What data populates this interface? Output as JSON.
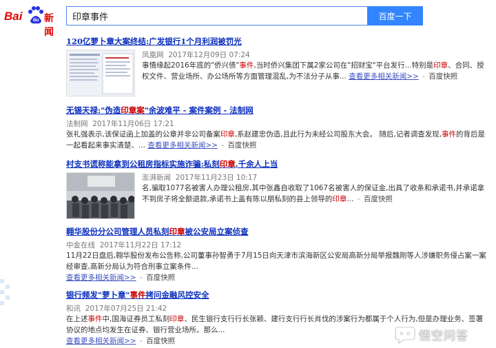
{
  "logo": {
    "bai": "Bai",
    "news": "新闻"
  },
  "search": {
    "query": "印章事件",
    "button_label": "百度一下"
  },
  "results": [
    {
      "title_parts": [
        "120亿萝卜章大案终结:广发银行1个月利润被罚光"
      ],
      "source": "凤凰网",
      "time": "2017年12月09日 07:24",
      "snippet_a": "事情缘起2016年底的\"侨兴债\"",
      "snippet_em1": "事件",
      "snippet_b": ",当时侨兴集团下属2家公司在\"招财宝\"平台发行...特别是",
      "snippet_em2": "印章",
      "snippet_c": "、合同、授权文件、营业场所、办公场所等方面管理混乱,为不法分子从事...",
      "more": "查看更多相关新闻>>",
      "cache": "百度快照"
    },
    {
      "title_a": "无锡天禄:\"伪造",
      "title_em": "印章案",
      "title_b": "\"余波难平 - 案件案例 - 法制网",
      "source": "法制网",
      "time": "2017年11月06日 17:21",
      "snippet_a": "张礼强表示,该保证函上加盖的公章并非公司备案",
      "snippet_em1": "印章",
      "snippet_b": ",系赵建忠伪造,且此行为未经公司股东大会。 随后,记者调查发现,",
      "snippet_em2": "事件",
      "snippet_c": "的背后是一起看起来事实清楚、...",
      "more": "查看更多相关新闻>>",
      "cache": "百度快照"
    },
    {
      "title_a": "村支书谎称能拿到公租房指标实施诈骗:私刻",
      "title_em": "印章",
      "title_b": ",千余人上当",
      "source": "澎湃新闻",
      "time": "2017年11月23日 10:17",
      "snippet_a": "名,骗取1077名被害人办理公租房,其中张鑫自收取了1067名被害人的保证金,出具了收条和承诺书,并承诺拿不到房子将全额退款,承诺书上盖有陈以朋私刻的县上领导的",
      "snippet_em1": "印章",
      "snippet_b": "...",
      "cache": "百度快照"
    },
    {
      "title_a": "翱华股份分公司管理人员私刻",
      "title_em": "印章",
      "title_b": "被公安局立案侦查",
      "source": "中金在线",
      "time": "2017年11月22日 17:12",
      "snippet_a": "11月22日盘后,翱华股份发布公告称,公司董事孙智勇于7月15日向天津市滨海新区公安局高新分局举报魏刚等人涉嫌职务侵占案一案经审查,高新分局认为符合刑事立案条件...",
      "more": "查看更多相关新闻>>",
      "cache": "百度快照"
    },
    {
      "title_a": "银行频发\"萝卜章\"",
      "title_em": "事件",
      "title_b": "拷问金融风控安全",
      "source": "和讯",
      "time": "2017年07月25日 21:42",
      "snippet_a": "在上述",
      "snippet_em1": "事件",
      "snippet_b": "中,国海证券员工私刻",
      "snippet_em2": "印章",
      "snippet_c": "、民生银行支行行长张颖、建行支行行长肖伐的涉案行为都属于个人行为,但是办理业务、签署协议的地点均发生在证券、银行营业场所。那么...",
      "more": "查看更多相关新闻>>",
      "cache": "百度快照"
    }
  ],
  "watermark": {
    "text": "悟空问答"
  }
}
